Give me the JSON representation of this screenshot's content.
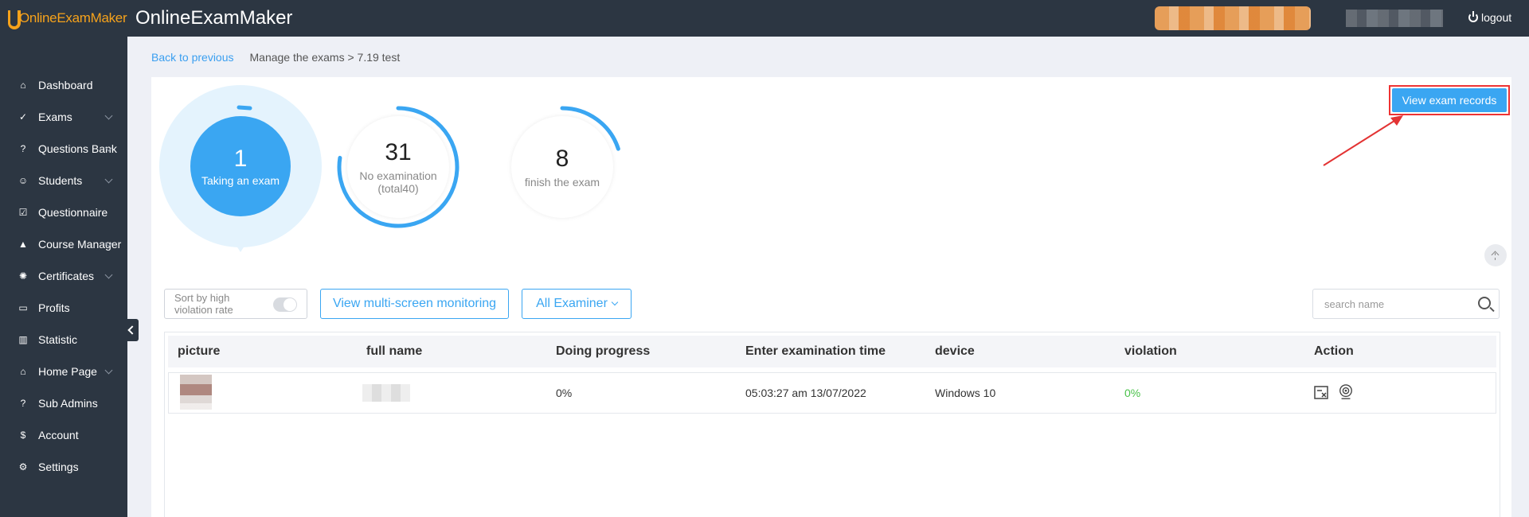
{
  "header": {
    "logo_text": "OnlineExamMaker",
    "app_title": "OnlineExamMaker",
    "logout_label": "logout"
  },
  "sidebar": {
    "items": [
      {
        "label": "Dashboard",
        "icon": "home-icon",
        "has_submenu": false
      },
      {
        "label": "Exams",
        "icon": "check-circle-icon",
        "has_submenu": true
      },
      {
        "label": "Questions Bank",
        "icon": "question-circle-icon",
        "has_submenu": true
      },
      {
        "label": "Students",
        "icon": "users-icon",
        "has_submenu": true
      },
      {
        "label": "Questionnaire",
        "icon": "checkbox-icon",
        "has_submenu": false
      },
      {
        "label": "Course Manager",
        "icon": "graduation-cap-icon",
        "has_submenu": true
      },
      {
        "label": "Certificates",
        "icon": "badge-icon",
        "has_submenu": true
      },
      {
        "label": "Profits",
        "icon": "credit-card-icon",
        "has_submenu": false
      },
      {
        "label": "Statistic",
        "icon": "bar-chart-icon",
        "has_submenu": false
      },
      {
        "label": "Home Page",
        "icon": "home-page-icon",
        "has_submenu": true
      },
      {
        "label": "Sub Admins",
        "icon": "question-circle-icon",
        "has_submenu": false
      },
      {
        "label": "Account",
        "icon": "dollar-icon",
        "has_submenu": false
      },
      {
        "label": "Settings",
        "icon": "gear-icon",
        "has_submenu": false
      }
    ]
  },
  "breadcrumb": {
    "back": "Back to previous",
    "path": "Manage the exams",
    "current": "> 7.19 test"
  },
  "stats": {
    "taking": {
      "value": "1",
      "label": "Taking an exam"
    },
    "no_exam": {
      "value": "31",
      "label": "No examination",
      "sublabel": "(total40)",
      "fraction": 0.775
    },
    "finished": {
      "value": "8",
      "label": "finish the exam",
      "fraction": 0.2
    }
  },
  "actions": {
    "view_records": "View exam records"
  },
  "filters": {
    "sort_label": "Sort by high violation rate",
    "multi_screen": "View multi-screen monitoring",
    "examiner": "All Examiner",
    "search_placeholder": "search name"
  },
  "table": {
    "columns": [
      "picture",
      "full name",
      "Doing progress",
      "Enter examination time",
      "device",
      "violation",
      "Action"
    ],
    "rows": [
      {
        "progress": "0%",
        "enter_time": "05:03:27 am 13/07/2022",
        "device": "Windows 10",
        "violation": "0%"
      }
    ]
  },
  "colors": {
    "accent": "#3aa6f2",
    "sidebar_bg": "#2c3642",
    "logo": "#f6a21b",
    "violation_ok": "#4ac24a",
    "highlight_red": "#e33333"
  }
}
